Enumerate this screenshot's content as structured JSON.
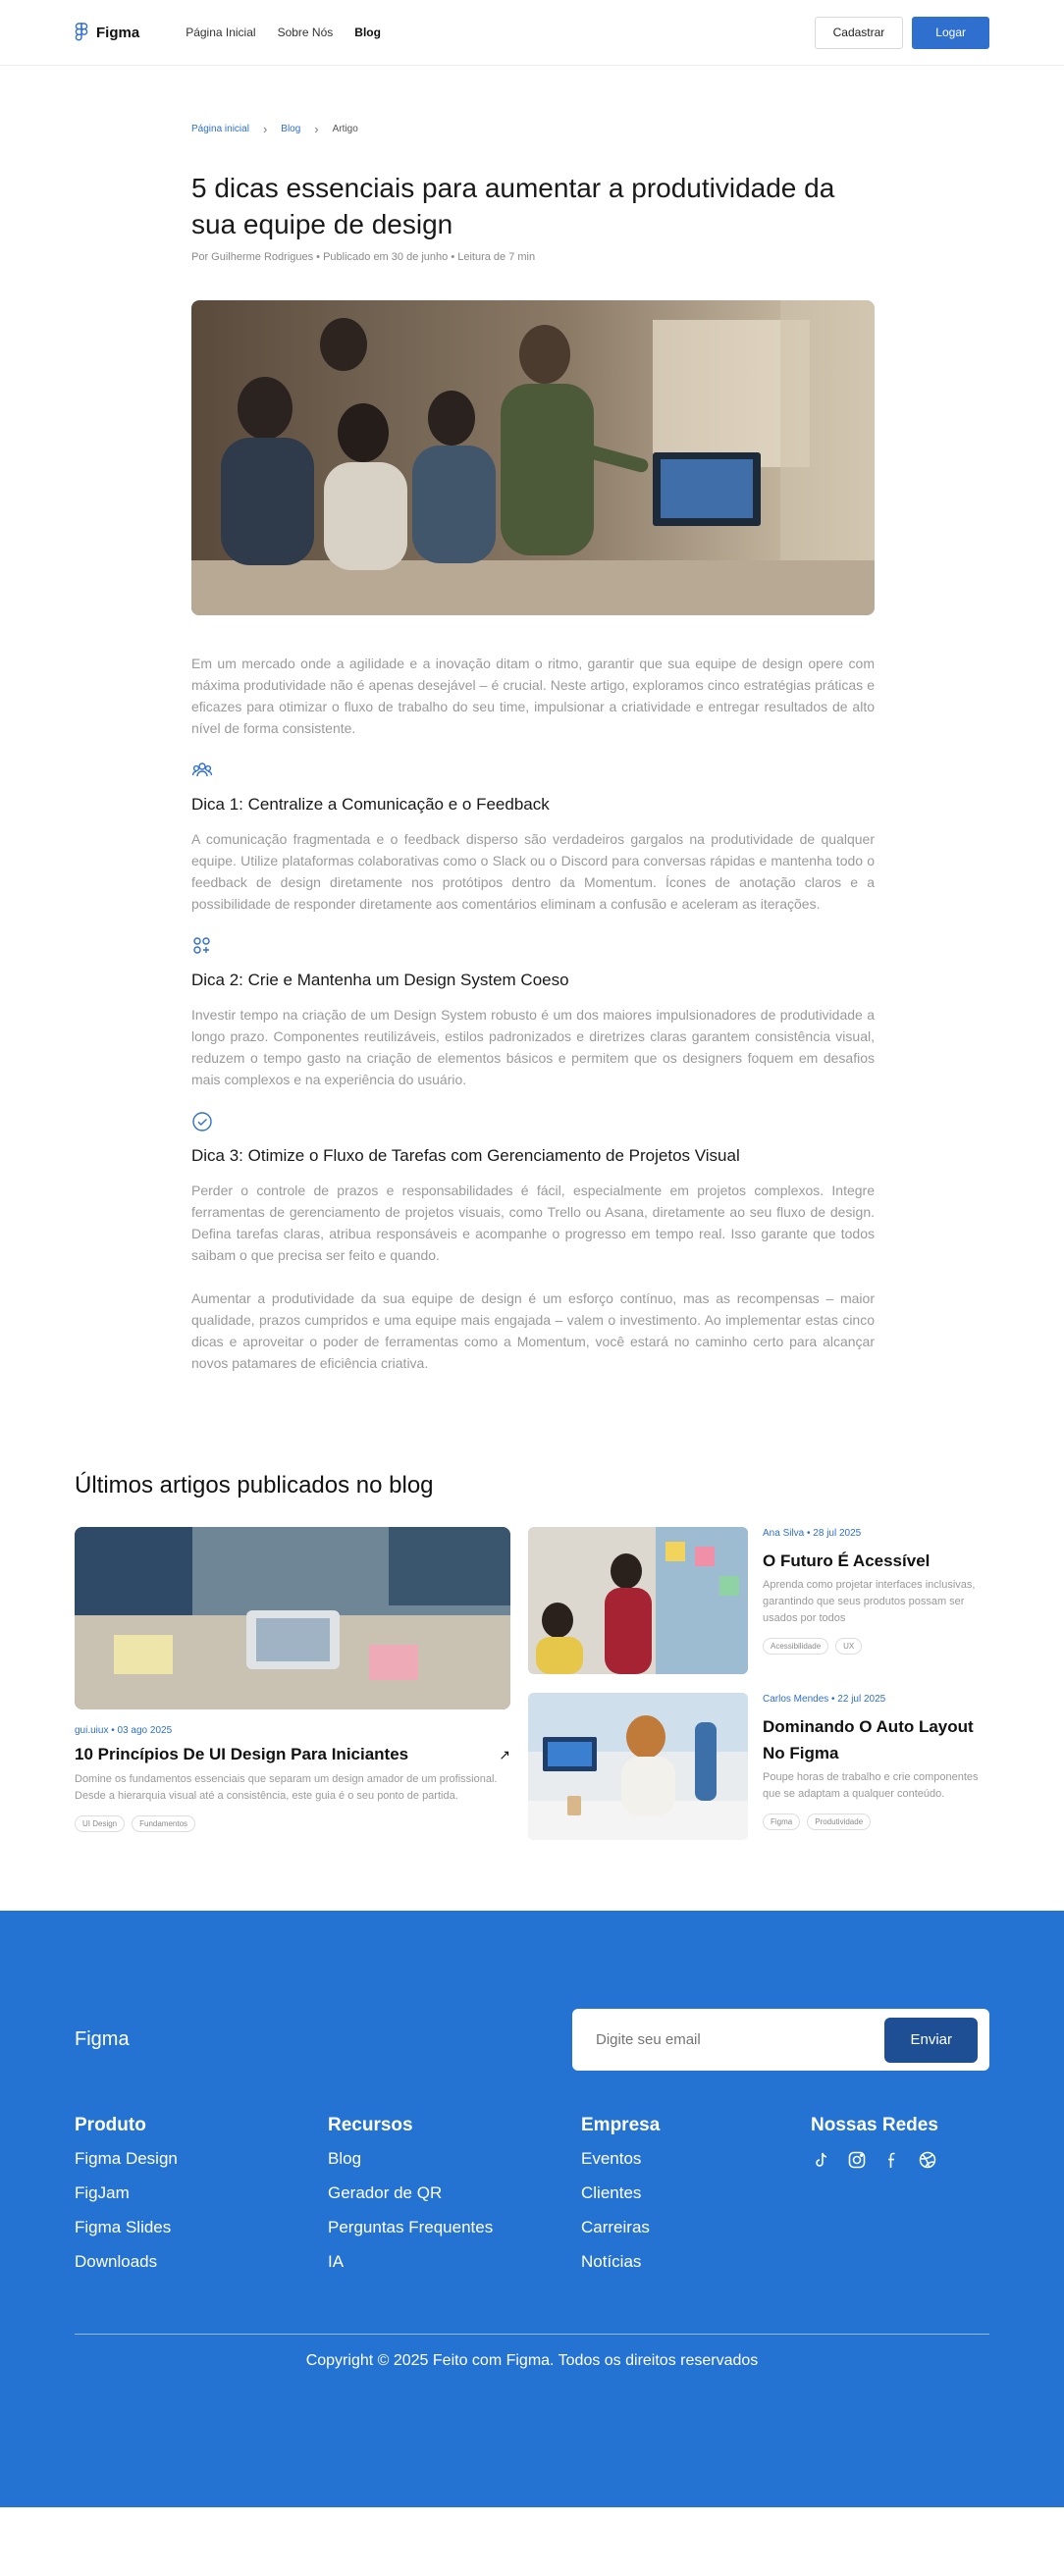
{
  "header": {
    "brand": "Figma",
    "nav": [
      "Página Inicial",
      "Sobre Nós",
      "Blog"
    ],
    "signup_label": "Cadastrar",
    "login_label": "Logar"
  },
  "breadcrumb": {
    "home": "Página inicial",
    "blog": "Blog",
    "current": "Artigo"
  },
  "article": {
    "title": "5 dicas essenciais para aumentar a produtividade da sua equipe de design",
    "meta": "Por Guilherme Rodrigues • Publicado em 30 de junho • Leitura de 7 min",
    "intro": "Em um mercado onde a agilidade e a inovação ditam o ritmo, garantir que sua equipe de design opere com máxima produtividade não é apenas desejável – é crucial. Neste artigo, exploramos cinco estratégias práticas e eficazes para otimizar o fluxo de trabalho do seu time, impulsionar a criatividade e entregar resultados de alto nível de forma consistente.",
    "tips": [
      {
        "icon": "users-icon",
        "title": "Dica 1: Centralize a Comunicação e o Feedback",
        "body": "A comunicação fragmentada e o feedback disperso são verdadeiros gargalos na produtividade de qualquer equipe. Utilize plataformas colaborativas como o Slack ou o Discord para conversas rápidas e mantenha todo o feedback de design diretamente nos protótipos dentro da Momentum. Ícones de anotação claros e a possibilidade de responder diretamente aos comentários eliminam a confusão e aceleram as iterações."
      },
      {
        "icon": "components-icon",
        "title": "Dica 2: Crie e Mantenha um Design System Coeso",
        "body": "Investir tempo na criação de um Design System robusto é um dos maiores impulsionadores de produtividade a longo prazo. Componentes reutilizáveis, estilos padronizados e diretrizes claras garantem consistência visual, reduzem o tempo gasto na criação de elementos básicos e permitem que os designers foquem em desafios mais complexos e na experiência do usuário."
      },
      {
        "icon": "check-circle-icon",
        "title": "Dica 3: Otimize o Fluxo de Tarefas com Gerenciamento de Projetos Visual",
        "body": "Perder o controle de prazos e responsabilidades é fácil, especialmente em projetos complexos. Integre ferramentas de gerenciamento de projetos visuais, como Trello ou Asana, diretamente ao seu fluxo de design. Defina tarefas claras, atribua responsáveis e acompanhe o progresso em tempo real. Isso garante que todos saibam o que precisa ser feito e quando."
      }
    ],
    "conclusion": "Aumentar a produtividade da sua equipe de design é um esforço contínuo, mas as recompensas – maior qualidade, prazos cumpridos e uma equipe mais engajada – valem o investimento. Ao implementar estas cinco dicas e aproveitar o poder de ferramentas como a Momentum, você estará no caminho certo para alcançar novos patamares de eficiência criativa."
  },
  "latest": {
    "title": "Últimos artigos publicados no blog",
    "featured": {
      "meta": "gui.uiux • 03 ago 2025",
      "title": "10 Princípios De UI Design Para Iniciantes",
      "desc": "Domine os fundamentos essenciais que separam um design amador de um profissional. Desde a hierarquia visual até a consistência, este guia é o seu ponto de partida.",
      "tags": [
        "UI Design",
        "Fundamentos"
      ]
    },
    "posts": [
      {
        "meta": "Ana Silva • 28 jul 2025",
        "title": "O Futuro É Acessível",
        "desc": "Aprenda como projetar interfaces inclusivas, garantindo que seus produtos possam ser usados por todos",
        "tags": [
          "Acessibilidade",
          "UX"
        ]
      },
      {
        "meta": "Carlos Mendes • 22 jul 2025",
        "title": "Dominando O Auto Layout No Figma",
        "desc": "Poupe horas de trabalho e crie componentes que se adaptam a qualquer conteúdo.",
        "tags": [
          "Figma",
          "Produtividade"
        ]
      }
    ]
  },
  "footer": {
    "brand": "Figma",
    "email_placeholder": "Digite seu email",
    "send_label": "Enviar",
    "columns": [
      {
        "title": "Produto",
        "links": [
          "Figma Design",
          "FigJam",
          "Figma Slides",
          "Downloads"
        ]
      },
      {
        "title": "Recursos",
        "links": [
          "Blog",
          "Gerador de QR",
          "Perguntas Frequentes",
          "IA"
        ]
      },
      {
        "title": "Empresa",
        "links": [
          "Eventos",
          "Clientes",
          "Carreiras",
          "Notícias"
        ]
      }
    ],
    "social_title": "Nossas Redes",
    "socials": [
      "tiktok-icon",
      "instagram-icon",
      "facebook-icon",
      "dribbble-icon"
    ],
    "copyright": "Copyright © 2025 Feito com Figma. Todos os direitos reservados"
  },
  "colors": {
    "accent": "#2f6fce",
    "footer_bg": "#2473d3",
    "button_dark": "#1e4f95"
  }
}
